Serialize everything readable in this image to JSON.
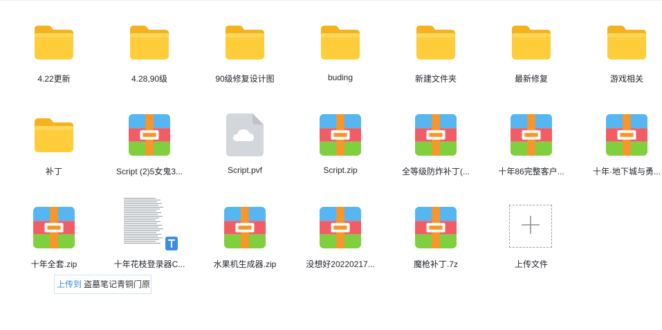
{
  "files": [
    {
      "name": "4.22更新",
      "type": "folder"
    },
    {
      "name": "4.28,90级",
      "type": "folder"
    },
    {
      "name": "90级修复设计图",
      "type": "folder"
    },
    {
      "name": "buding",
      "type": "folder"
    },
    {
      "name": "新建文件夹",
      "type": "folder"
    },
    {
      "name": "最新修复",
      "type": "folder"
    },
    {
      "name": "游戏相关",
      "type": "folder"
    },
    {
      "name": "补丁",
      "type": "folder"
    },
    {
      "name": "Script (2)5女鬼3...",
      "type": "archive"
    },
    {
      "name": "Script.pvf",
      "type": "cloud-file"
    },
    {
      "name": "Script.zip",
      "type": "archive"
    },
    {
      "name": "全等级防炸补丁(...",
      "type": "archive"
    },
    {
      "name": "十年86完整客户...",
      "type": "archive"
    },
    {
      "name": "十年·地下城与勇...",
      "type": "archive"
    },
    {
      "name": "十年全套.zip",
      "type": "archive"
    },
    {
      "name": "十年花枝登录器C...",
      "type": "document"
    },
    {
      "name": "水果机生成器.zip",
      "type": "archive"
    },
    {
      "name": "没想好20220217...",
      "type": "archive"
    },
    {
      "name": "魔枪补丁.7z",
      "type": "archive"
    }
  ],
  "upload": {
    "label": "上传文件"
  },
  "tooltip": {
    "prefix": "上传到",
    "target": "盗墓笔记青铜门原"
  },
  "colors": {
    "folder": "#ffc933",
    "archive_top": "#56b6f2",
    "archive_red": "#f25c64",
    "archive_green": "#7fcf3e",
    "archive_strap": "#f7962b",
    "accent": "#3a8ee6"
  }
}
